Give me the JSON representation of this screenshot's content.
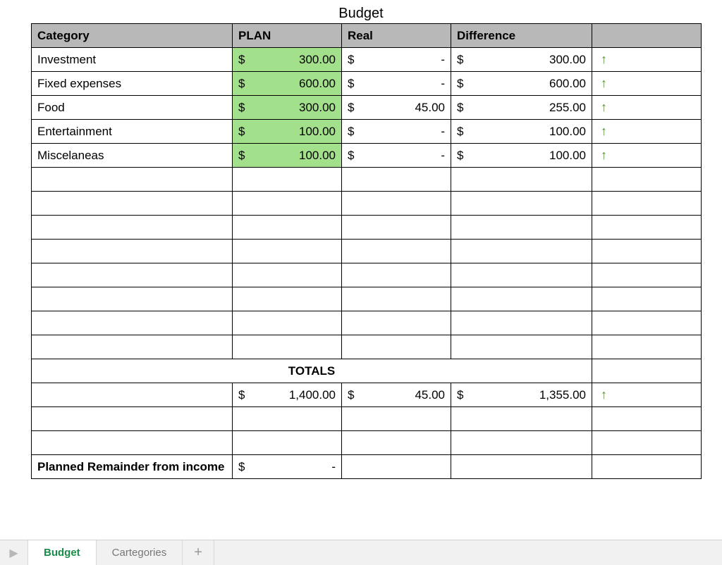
{
  "title": "Budget",
  "headers": {
    "category": "Category",
    "plan": "PLAN",
    "real": "Real",
    "difference": "Difference"
  },
  "currency": "$",
  "rows": [
    {
      "category": "Investment",
      "plan": "300.00",
      "real": "-",
      "difference": "300.00",
      "arrow": "↑"
    },
    {
      "category": "Fixed expenses",
      "plan": "600.00",
      "real": "-",
      "difference": "600.00",
      "arrow": "↑"
    },
    {
      "category": "Food",
      "plan": "300.00",
      "real": "45.00",
      "difference": "255.00",
      "arrow": "↑"
    },
    {
      "category": "Entertainment",
      "plan": "100.00",
      "real": "-",
      "difference": "100.00",
      "arrow": "↑"
    },
    {
      "category": "Miscelaneas",
      "plan": "100.00",
      "real": "-",
      "difference": "100.00",
      "arrow": "↑"
    }
  ],
  "empty_rows": 8,
  "totals_label": "TOTALS",
  "totals": {
    "plan": "1,400.00",
    "real": "45.00",
    "difference": "1,355.00",
    "arrow": "↑"
  },
  "remainder_label": "Planned Remainder from income",
  "remainder_value": "-",
  "tabs": {
    "active": "Budget",
    "other": "Cartegories"
  }
}
